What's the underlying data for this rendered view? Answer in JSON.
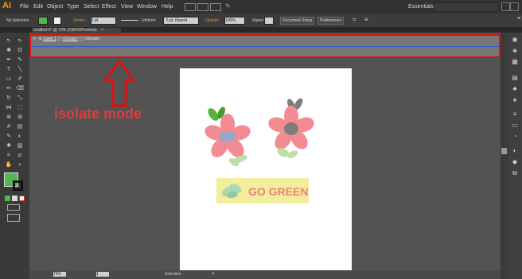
{
  "app": {
    "logo": "Ai"
  },
  "menu": [
    "File",
    "Edit",
    "Object",
    "Type",
    "Select",
    "Effect",
    "View",
    "Window",
    "Help"
  ],
  "workspace": "Essentials",
  "control_bar": {
    "selection_label": "No Selection",
    "stroke_label": "Stroke:",
    "stroke_value": "1 pt",
    "profile": "Uniform",
    "brush": "5 pt. Round",
    "opacity_label": "Opacity:",
    "opacity_value": "100%",
    "styles_label": "Styles:",
    "document_setup": "Document Setup",
    "preferences": "Preferences"
  },
  "document_tab": "Untitled-2* @ 73% (CMYK/Preview)",
  "isolation": {
    "layer": "Layer 1",
    "group1": "<Group>",
    "group2": "<Group>"
  },
  "annotation": "isolate mode",
  "artwork": {
    "go_green": "GO GREEN"
  },
  "status": {
    "zoom": "73%",
    "page": "1",
    "mode": "Selection"
  },
  "colors": {
    "annotation_red": "#e01010",
    "fill_green": "#4fb84f",
    "flower_pink": "#f28b92",
    "center_blue": "#9ba6c7",
    "center_grey": "#7d7d7d",
    "leaf_green": "#5cb33a"
  }
}
